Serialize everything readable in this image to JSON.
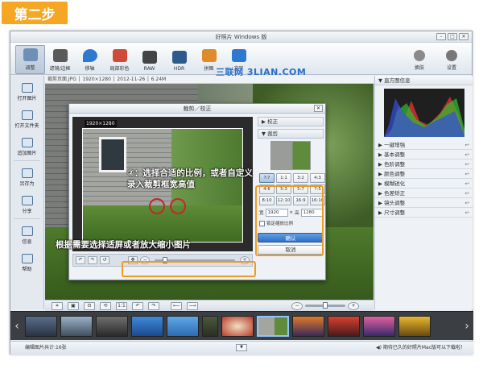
{
  "step_badge": "第二步",
  "window": {
    "title": "好照片 Windows 版",
    "min": "–",
    "max": "□",
    "close": "✕"
  },
  "toolbar": {
    "tools": [
      {
        "label": "调整",
        "icon": "pencil-icon",
        "color": "#6d8fb8"
      },
      {
        "label": "滤镜/边框",
        "icon": "filter-icon",
        "color": "#5a5a5a"
      },
      {
        "label": "移轴",
        "icon": "droplet-icon",
        "color": "#2f78d0"
      },
      {
        "label": "局部彩色",
        "icon": "brush-icon",
        "color": "#d04a3a"
      },
      {
        "label": "RAW",
        "icon": "camera-icon",
        "color": "#444444"
      },
      {
        "label": "HDR",
        "icon": "hdr-icon",
        "color": "#2d5a8c"
      },
      {
        "label": "拼图",
        "icon": "collage-icon",
        "color": "#e08a2a"
      },
      {
        "label": "文字",
        "icon": "text-icon",
        "color": "#2f78d0"
      }
    ],
    "right": [
      {
        "label": "换肤",
        "icon": "skin-icon"
      },
      {
        "label": "设置",
        "icon": "gear-icon"
      }
    ],
    "watermark": "三联网 3LIAN.COM"
  },
  "left_panel": {
    "items": [
      {
        "label": "打开图片",
        "icon": "open-image-icon"
      },
      {
        "label": "打开文件夹",
        "icon": "open-folder-icon"
      },
      {
        "label": "追加图片",
        "icon": "add-image-icon"
      },
      {
        "label": "另存为",
        "icon": "save-icon"
      },
      {
        "label": "分享",
        "icon": "share-icon"
      },
      {
        "label": "信息",
        "icon": "info-icon"
      },
      {
        "label": "帮助",
        "icon": "help-icon"
      }
    ]
  },
  "infobar": "裁剪页面.JPG │ 1920×1280 │ 2012-11-26 │ 6.24M",
  "dialog": {
    "title": "裁剪／校正",
    "close": "✕",
    "dimension_label": "1920×1280",
    "sections": {
      "correct": "校正",
      "crop": "裁剪"
    },
    "ratios": [
      "?:?",
      "1:1",
      "3:2",
      "4:3",
      "4:6",
      "5:3",
      "5:7",
      "7:5",
      "8:10",
      "12:10",
      "16:9",
      "16:10"
    ],
    "width_label": "宽",
    "width_value": "1920",
    "times": "×",
    "height_label": "高",
    "height_value": "1280",
    "lock_label": "锁定缩放比例",
    "ok": "确认",
    "cancel": "取消"
  },
  "annotations": {
    "ratio_hint": "②：选择合适的比例，或者自定义录入裁剪框宽高值",
    "zoom_hint": "根据需要选择适屏或者放大缩小图片"
  },
  "right_panel": {
    "histogram_title": "直方图信息",
    "adjustments": [
      "一键增强",
      "基本调整",
      "色阶调整",
      "颜色调整",
      "模糊锐化",
      "色差矫正",
      "镜头调整",
      "尺寸调整"
    ]
  },
  "bottom_tools": [
    "crop-icon",
    "fit-icon",
    "actual-size-icon",
    "rotate-icon"
  ],
  "bottom_ratio": "1:1",
  "filmstrip_count": 12,
  "statusbar": {
    "left": "编辑图片共计:16张",
    "right": "◀) 期待已久的好照片Mac版可以下载啦！"
  }
}
